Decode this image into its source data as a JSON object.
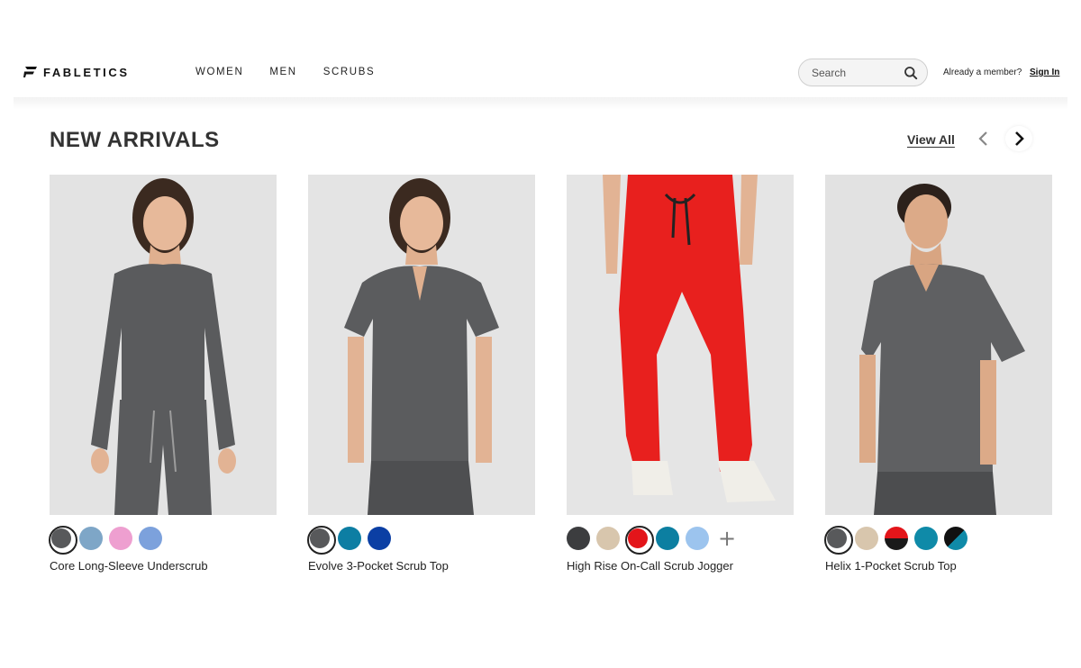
{
  "header": {
    "brand": "FABLETICS",
    "nav": [
      "WOMEN",
      "MEN",
      "SCRUBS"
    ],
    "search_placeholder": "Search",
    "member_text": "Already a member?",
    "signin_label": "Sign In"
  },
  "section": {
    "title": "NEW ARRIVALS",
    "view_all": "View All",
    "prev_icon": "chevron-left-icon",
    "next_icon": "chevron-right-icon"
  },
  "products": [
    {
      "name": "Core Long-Sleeve Underscrub",
      "background": "#e3e3e3",
      "garment_color": "#5a5b5d",
      "swatches": [
        {
          "color": "#58595b",
          "selected": true
        },
        {
          "color": "#7ea6c7",
          "selected": false
        },
        {
          "color": "#ee9fd0",
          "selected": false
        },
        {
          "color": "#7ca1dc",
          "selected": false
        }
      ],
      "more": false
    },
    {
      "name": "Evolve 3-Pocket Scrub Top",
      "background": "#e4e4e4",
      "garment_color": "#5b5c5e",
      "swatches": [
        {
          "color": "#58595b",
          "selected": true
        },
        {
          "color": "#0d7ea3",
          "selected": false
        },
        {
          "color": "#0b3fa4",
          "selected": false
        }
      ],
      "more": false
    },
    {
      "name": "High Rise On-Call Scrub Jogger",
      "background": "#e5e5e5",
      "garment_color": "#e8201e",
      "swatches": [
        {
          "color": "#3c3d3f",
          "selected": false
        },
        {
          "color": "#d8c6ad",
          "selected": false
        },
        {
          "color": "#e3151a",
          "selected": true
        },
        {
          "color": "#0c7fa1",
          "selected": false
        },
        {
          "color": "#9cc4ee",
          "selected": false
        }
      ],
      "more": true
    },
    {
      "name": "Helix 1-Pocket Scrub Top",
      "background": "#e2e2e2",
      "garment_color": "#5f6062",
      "swatches": [
        {
          "color": "#58595b",
          "selected": true
        },
        {
          "color": "#d8c6ad",
          "selected": false
        },
        {
          "color": "split-red-black",
          "selected": false
        },
        {
          "color": "#0f8aa8",
          "selected": false
        },
        {
          "color": "split-black-teal",
          "selected": false
        }
      ],
      "more": false
    }
  ]
}
